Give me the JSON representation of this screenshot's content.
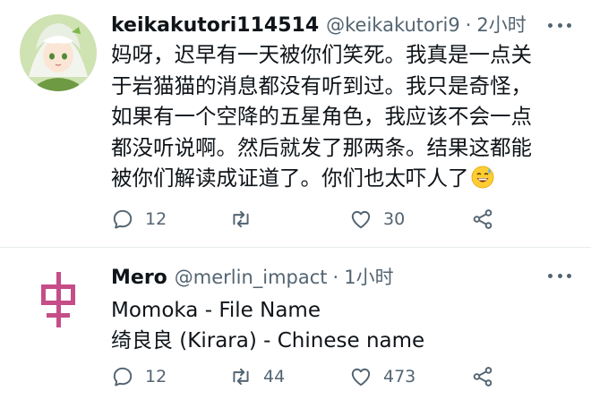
{
  "tweets": [
    {
      "display_name": "keikakutori114514",
      "handle": "@keikakutori9",
      "separator": "·",
      "time": "2小时",
      "body_lines": [
        "妈呀，迟早有一天被你们笑死。我真是一点关",
        "于岩猫猫的消息都没有听到过。我只是奇怪，",
        "如果有一个空降的五星角色，我应该不会一点",
        "都没听说啊。然后就发了那两条。结果这都能",
        "被你们解读成证道了。你们也太吓人了"
      ],
      "emoji": "grinning-sweat-emoji",
      "reply_count": "12",
      "retweet_count": "",
      "like_count": "30"
    },
    {
      "display_name": "Mero",
      "handle": "@merlin_impact",
      "separator": "·",
      "time": "1小时",
      "body_lines": [
        "Momoka - File Name",
        "绮良良 (Kirara) - Chinese name"
      ],
      "reply_count": "12",
      "retweet_count": "44",
      "like_count": "473"
    }
  ],
  "colors": {
    "text": "#0f1419",
    "secondary": "#536471",
    "divider": "#e6ecf0",
    "avatar2_glyph": "#c03a7a"
  },
  "icons": [
    "more-icon",
    "reply-icon",
    "retweet-icon",
    "like-icon",
    "share-icon"
  ]
}
